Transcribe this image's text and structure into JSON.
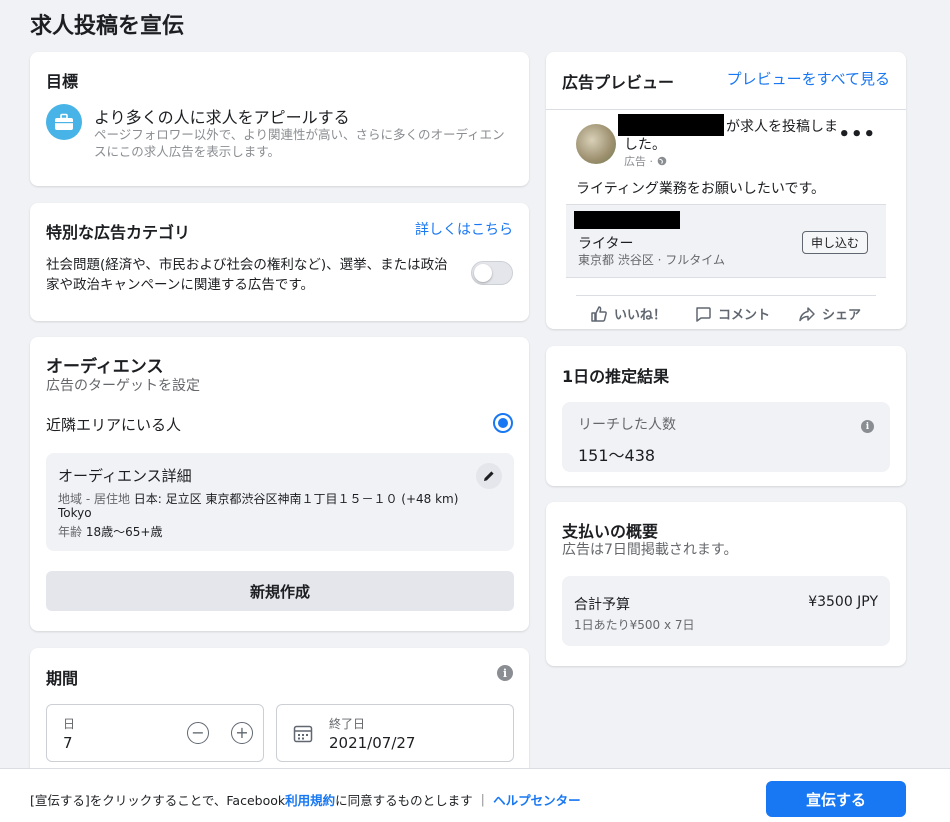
{
  "page": {
    "title": "求人投稿を宣伝"
  },
  "goal": {
    "title": "目標",
    "icon": "briefcase-icon",
    "option_title": "より多くの人に求人をアピールする",
    "option_desc": "ページフォロワー以外で、より関連性が高い、さらに多くのオーディエンスにこの求人広告を表示します。"
  },
  "special_category": {
    "title": "特別な広告カテゴリ",
    "learn_more": "詳しくはこちら",
    "description": "社会問題(経済や、市民および社会の権利など)、選挙、または政治家や政治キャンペーンに関連する広告です。",
    "toggle_on": false
  },
  "audience": {
    "title": "オーディエンス",
    "subtitle": "広告のターゲットを設定",
    "option": "近隣エリアにいる人",
    "selected": true,
    "detail_title": "オーディエンス詳細",
    "location_label": "地域 - 居住地",
    "location_value": "日本: 足立区 東京都渋谷区神南１丁目１５－１０ (+48 km)",
    "location_city": "Tokyo",
    "age_label": "年齢",
    "age_value": "18歳〜65+歳",
    "create_button": "新規作成"
  },
  "period": {
    "title": "期間",
    "days_label": "日",
    "days_value": "7",
    "minus": "−",
    "plus": "+",
    "end_label": "終了日",
    "end_value": "2021/07/27"
  },
  "preview": {
    "title": "広告プレビュー",
    "see_all": "プレビューをすべて見る",
    "post_head": "が求人を投稿しました。",
    "post_meta": "広告 · ",
    "more": "•••",
    "post_text": "ライティング業務をお願いしたいです。",
    "job_title": "ライター",
    "job_location": "東京都 渋谷区 · フルタイム",
    "apply_button": "申し込む",
    "like": "いいね！",
    "comment": "コメント",
    "share": "シェア"
  },
  "estimate": {
    "title": "1日の推定結果",
    "reach_label": "リーチした人数",
    "reach_value": "151〜438"
  },
  "payment": {
    "title": "支払いの概要",
    "subtitle": "広告は7日間掲載されます。",
    "total_label": "合計予算",
    "total_amount": "¥3500 JPY",
    "per_day": "1日あたり¥500 x 7日"
  },
  "footer": {
    "prefix": "[宣伝する]をクリックすることで、Facebook",
    "terms": "利用規約",
    "suffix": "に同意するものとします ｜ ",
    "help": "ヘルプセンター",
    "promote_button": "宣伝する"
  },
  "colors": {
    "accent": "#1877f2",
    "background": "#f0f2f5",
    "icon_blue": "#47b3e6"
  }
}
